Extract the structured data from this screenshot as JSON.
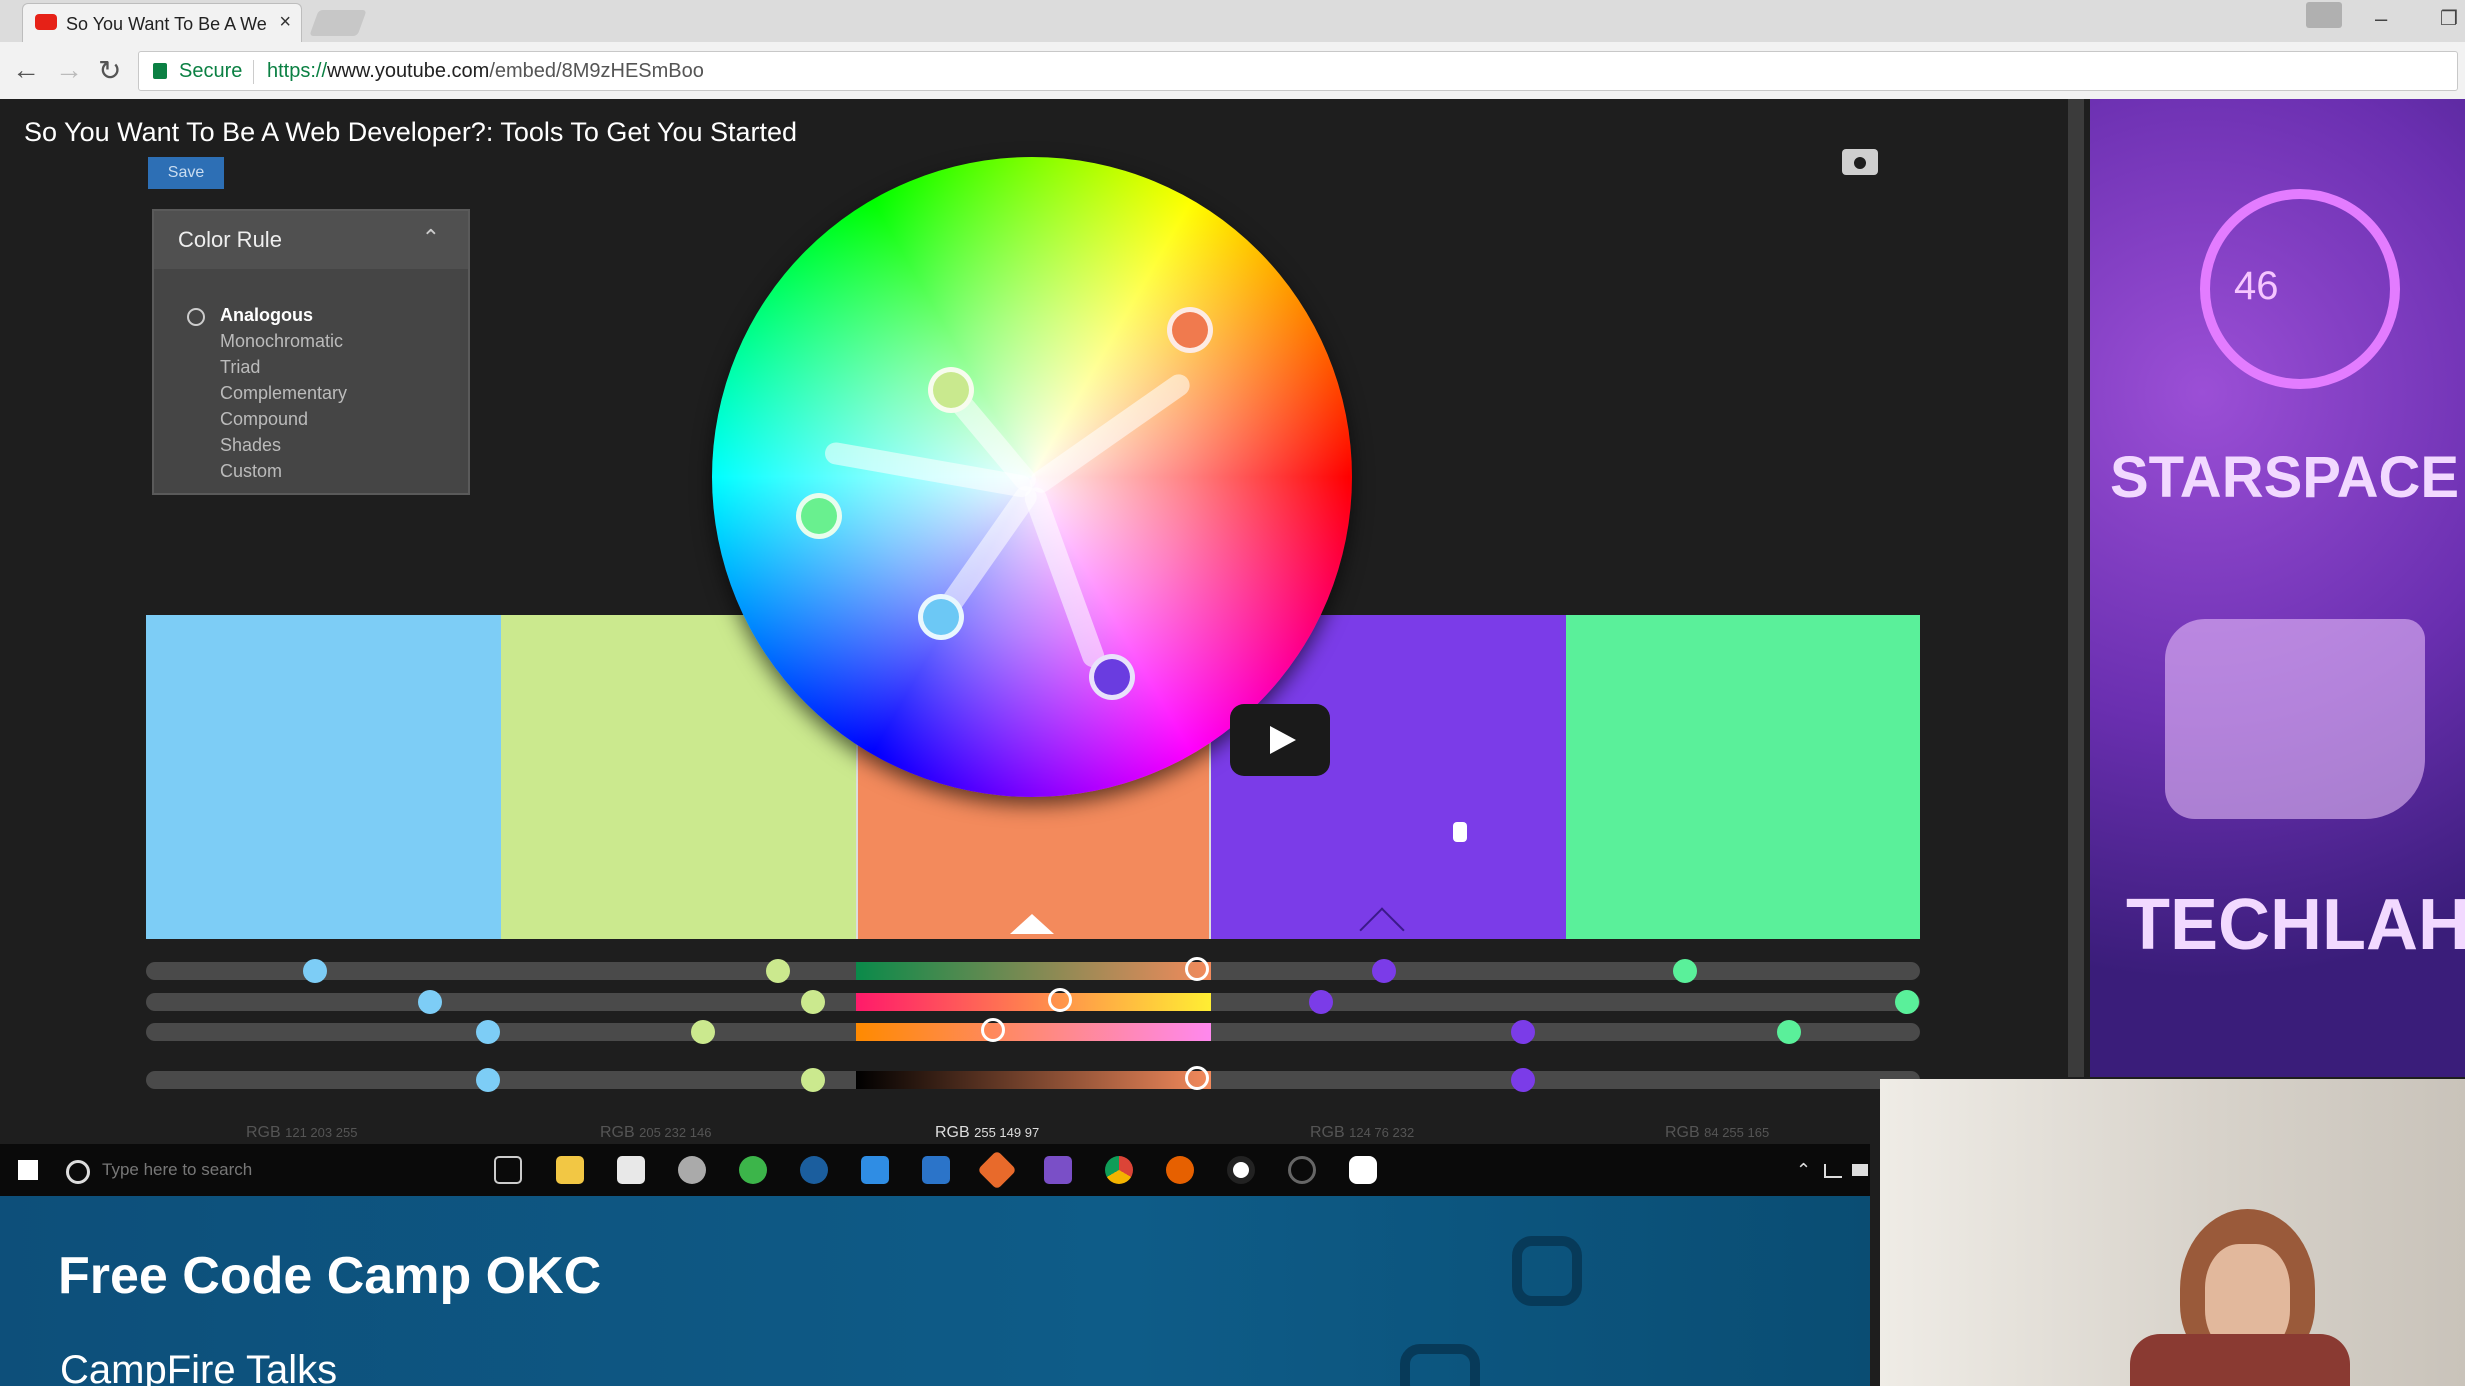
{
  "browser": {
    "tab_title": "So You Want To Be A We",
    "tab_close": "×",
    "secure_label": "Secure",
    "url_scheme": "https://",
    "url_host": "www.youtube.com",
    "url_path": "/embed/8M9zHESmBoo",
    "back": "←",
    "forward": "→",
    "reload": "↻",
    "minimize": "–",
    "restore": "❐"
  },
  "video": {
    "title": "So You Want To Be A Web Developer?: Tools To Get You Started"
  },
  "color_app": {
    "save_label": "Save",
    "panel_title": "Color Rule",
    "collapse_icon": "⌃",
    "rules": [
      "Analogous",
      "Monochromatic",
      "Triad",
      "Complementary",
      "Compound",
      "Shades",
      "Custom"
    ],
    "swatches": [
      "#7dcdf6",
      "#cbe98e",
      "#f38a5c",
      "#7b3ce8",
      "#5af09a"
    ],
    "rgb_labels": [
      {
        "label": "RGB",
        "values": "121 203 255"
      },
      {
        "label": "RGB",
        "values": "205 232 146"
      },
      {
        "label": "RGB",
        "values": "255 149 97"
      },
      {
        "label": "RGB",
        "values": "124 76 232"
      },
      {
        "label": "RGB",
        "values": "84 255 165"
      }
    ]
  },
  "taskbar": {
    "search_placeholder": "Type here to search"
  },
  "banner": {
    "title": "Free Code Camp OKC",
    "subtitle": "CampFire Talks"
  },
  "side_panel": {
    "badge_number": "46",
    "starspace": "STARSPACE",
    "techlahoma": "TECHLAHOM"
  }
}
